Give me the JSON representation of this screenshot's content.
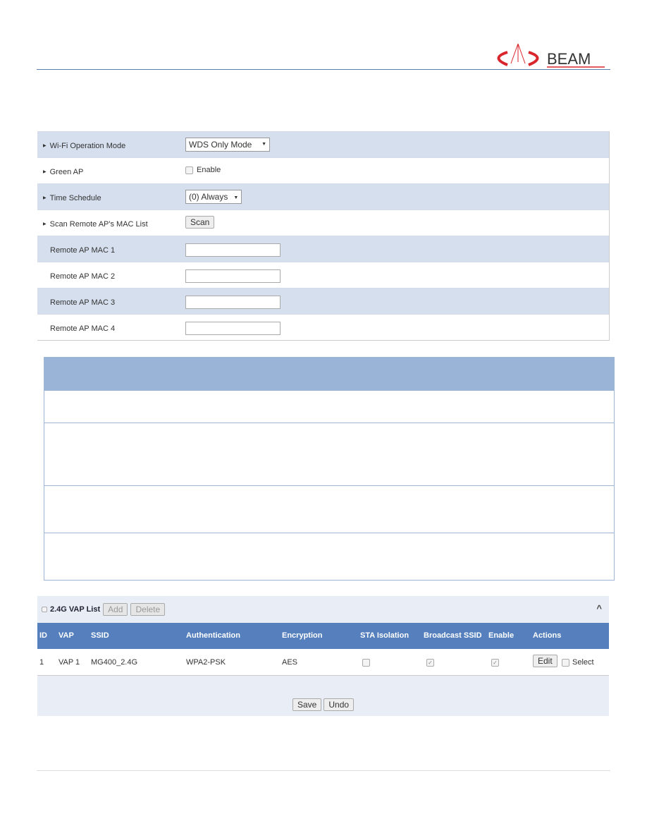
{
  "brand": {
    "logo_text": "BEAM",
    "colors": {
      "logo_red": "#d9262c",
      "header_blue": "#5580bd",
      "row_alt": "#d5dfee"
    }
  },
  "config": {
    "wifi_mode": {
      "label": "Wi-Fi Operation Mode",
      "value": "WDS Only Mode"
    },
    "green_ap": {
      "label": "Green AP",
      "checkbox_label": "Enable",
      "checked": false
    },
    "time_schedule": {
      "label": "Time Schedule",
      "value": "(0) Always"
    },
    "scan": {
      "label": "Scan Remote AP's MAC List",
      "button": "Scan"
    },
    "macs": [
      {
        "label": "Remote AP MAC 1",
        "value": ""
      },
      {
        "label": "Remote AP MAC 2",
        "value": ""
      },
      {
        "label": "Remote AP MAC 3",
        "value": ""
      },
      {
        "label": "Remote AP MAC 4",
        "value": ""
      }
    ]
  },
  "vap": {
    "title": "2.4G VAP List",
    "add": "Add",
    "delete": "Delete",
    "columns": [
      "ID",
      "VAP",
      "SSID",
      "Authentication",
      "Encryption",
      "STA Isolation",
      "Broadcast SSID",
      "Enable",
      "Actions"
    ],
    "rows": [
      {
        "id": "1",
        "vap": "VAP 1",
        "ssid": "MG400_2.4G",
        "auth": "WPA2-PSK",
        "enc": "AES",
        "sta_isolation": false,
        "broadcast_ssid": true,
        "enable": true,
        "edit": "Edit",
        "select": "Select"
      }
    ],
    "save": "Save",
    "undo": "Undo"
  }
}
